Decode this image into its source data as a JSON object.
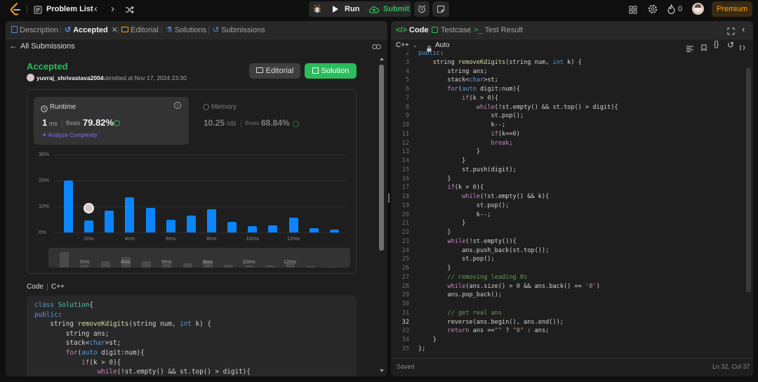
{
  "topbar": {
    "problem_list": "Problem List",
    "run": "Run",
    "submit": "Submit",
    "streak_count": "0",
    "premium": "Premium"
  },
  "left_tabs": [
    "Description",
    "Accepted",
    "Editorial",
    "Solutions",
    "Submissions"
  ],
  "submission": {
    "back_label": "All Submissions",
    "status": "Accepted",
    "username": "yuvraj_shrivastava2004",
    "submitted_text": "submitted at Nov 17, 2024 23:30",
    "editorial_btn": "Editorial",
    "solution_btn": "Solution"
  },
  "runtime": {
    "label": "Runtime",
    "value": "1",
    "unit": "ms",
    "beats_label": "Beats",
    "beats": "79.82%",
    "analyze": "Analyze Complexity"
  },
  "memory": {
    "label": "Memory",
    "value": "10.25",
    "unit": "MB",
    "beats_label": "Beats",
    "beats": "68.84%"
  },
  "chart_data": {
    "type": "bar",
    "y_ticks": [
      "30%",
      "20%",
      "10%",
      "0%"
    ],
    "ylim": [
      0,
      30
    ],
    "x_ticks": [
      "2ms",
      "4ms",
      "6ms",
      "8ms",
      "10ms",
      "12ms"
    ],
    "values": [
      20,
      4.5,
      8.5,
      13.5,
      9.5,
      5,
      6.5,
      9,
      4,
      2.3,
      2.8,
      5.8,
      1.5,
      1
    ],
    "marker_index": 1,
    "mini_values": [
      6,
      1,
      2.5,
      4,
      2.5,
      1.3,
      1.6,
      2.5,
      1.1,
      0.7,
      0.9,
      1.6,
      0.5,
      0.4
    ],
    "mini_ticks": [
      "2ms",
      "4ms",
      "6ms",
      "8ms",
      "10ms",
      "12ms"
    ]
  },
  "left_code": {
    "header_label": "Code",
    "language": "C++",
    "lines": [
      [
        [
          "kw",
          "class "
        ],
        [
          "ty",
          "Solution"
        ],
        [
          "",
          "{"
        ]
      ],
      [
        [
          "kw",
          "public"
        ],
        [
          "",
          ":"
        ]
      ],
      [
        [
          "",
          "    string "
        ],
        [
          "fn",
          "removeKdigits"
        ],
        [
          "",
          "(string num, "
        ],
        [
          "kw",
          "int"
        ],
        [
          "",
          " k) {"
        ]
      ],
      [
        [
          "",
          "        string ans;"
        ]
      ],
      [
        [
          "",
          "        stack<"
        ],
        [
          "kw",
          "char"
        ],
        [
          "",
          ">st;"
        ]
      ],
      [
        [
          "",
          "        "
        ],
        [
          "pl",
          "for"
        ],
        [
          "",
          "("
        ],
        [
          "kw",
          "auto"
        ],
        [
          "",
          " digit:num){"
        ]
      ],
      [
        [
          "",
          "            "
        ],
        [
          "pl",
          "if"
        ],
        [
          "",
          "(k > "
        ],
        [
          "nm",
          "0"
        ],
        [
          "",
          "){"
        ]
      ],
      [
        [
          "",
          "                "
        ],
        [
          "pl",
          "while"
        ],
        [
          "",
          "(!st.empty() && st.top() > digit){"
        ]
      ]
    ]
  },
  "right_tabs": [
    "Code",
    "Testcase",
    "Test Result"
  ],
  "editor": {
    "language": "C++",
    "auto_label": "Auto",
    "saved": "Saved",
    "cursor": "Ln 32, Col 37",
    "first_line_number": 2,
    "lines": [
      [
        [
          "kw",
          "public"
        ],
        [
          "",
          ":"
        ]
      ],
      [
        [
          "",
          "    string "
        ],
        [
          "fn",
          "removeKdigits"
        ],
        [
          "",
          "(string num, "
        ],
        [
          "kw",
          "int"
        ],
        [
          "",
          " k) {"
        ]
      ],
      [
        [
          "",
          "        string ans;"
        ]
      ],
      [
        [
          "",
          "        stack<"
        ],
        [
          "kw",
          "char"
        ],
        [
          "",
          ">st;"
        ]
      ],
      [
        [
          "",
          "        "
        ],
        [
          "pl",
          "for"
        ],
        [
          "",
          "("
        ],
        [
          "kw",
          "auto"
        ],
        [
          "",
          " digit:num){"
        ]
      ],
      [
        [
          "",
          "            "
        ],
        [
          "pl",
          "if"
        ],
        [
          "",
          "(k > "
        ],
        [
          "nm",
          "0"
        ],
        [
          "",
          "){"
        ]
      ],
      [
        [
          "",
          "                "
        ],
        [
          "pl",
          "while"
        ],
        [
          "",
          "(!st.empty() && st.top() > digit){"
        ]
      ],
      [
        [
          "",
          "                    st.pop();"
        ]
      ],
      [
        [
          "",
          "                    k--;"
        ]
      ],
      [
        [
          "",
          "                    "
        ],
        [
          "pl",
          "if"
        ],
        [
          "",
          "(k=="
        ],
        [
          "nm",
          "0"
        ],
        [
          "",
          ")"
        ]
      ],
      [
        [
          "",
          "                    "
        ],
        [
          "pl",
          "break"
        ],
        [
          "",
          ";"
        ]
      ],
      [
        [
          "",
          "                }"
        ]
      ],
      [
        [
          "",
          "            }"
        ]
      ],
      [
        [
          "",
          "            st.push(digit);"
        ]
      ],
      [
        [
          "",
          "        }"
        ]
      ],
      [
        [
          "",
          "        "
        ],
        [
          "pl",
          "if"
        ],
        [
          "",
          "(k > "
        ],
        [
          "nm",
          "0"
        ],
        [
          "",
          "){"
        ]
      ],
      [
        [
          "",
          "            "
        ],
        [
          "pl",
          "while"
        ],
        [
          "",
          "(!st.empty() && k){"
        ]
      ],
      [
        [
          "",
          "                st.pop();"
        ]
      ],
      [
        [
          "",
          "                k--;"
        ]
      ],
      [
        [
          "",
          "            }"
        ]
      ],
      [
        [
          "",
          "        }"
        ]
      ],
      [
        [
          "",
          "        "
        ],
        [
          "pl",
          "while"
        ],
        [
          "",
          "(!st.empty()){"
        ]
      ],
      [
        [
          "",
          "            ans.push_back(st.top());"
        ]
      ],
      [
        [
          "",
          "            st.pop();"
        ]
      ],
      [
        [
          "",
          "        }"
        ]
      ],
      [
        [
          "",
          "        "
        ],
        [
          "cm",
          "// removing leading 0s"
        ]
      ],
      [
        [
          "",
          "        "
        ],
        [
          "pl",
          "while"
        ],
        [
          "",
          "(ans.size() > "
        ],
        [
          "nm",
          "0"
        ],
        [
          "",
          " && ans.back() == "
        ],
        [
          "st",
          "'0'"
        ],
        [
          "",
          ")"
        ]
      ],
      [
        [
          "",
          "        ans.pop_back();"
        ]
      ],
      [
        [
          "",
          ""
        ]
      ],
      [
        [
          "",
          "        "
        ],
        [
          "cm",
          "// get real ans"
        ]
      ],
      [
        [
          "",
          "        reverse(ans.begin(), ans.end());"
        ]
      ],
      [
        [
          "",
          "        "
        ],
        [
          "pl",
          "return"
        ],
        [
          "",
          " ans =="
        ],
        [
          "st",
          "\"\""
        ],
        [
          "",
          " ? "
        ],
        [
          "st",
          "\"0\""
        ],
        [
          "",
          " : ans;"
        ]
      ],
      [
        [
          "",
          "    }"
        ]
      ],
      [
        [
          "",
          "};"
        ]
      ]
    ]
  },
  "colors": {
    "accent_green": "#2cbb5d",
    "bar_blue": "#0a84ff",
    "premium": "#ffa116"
  }
}
